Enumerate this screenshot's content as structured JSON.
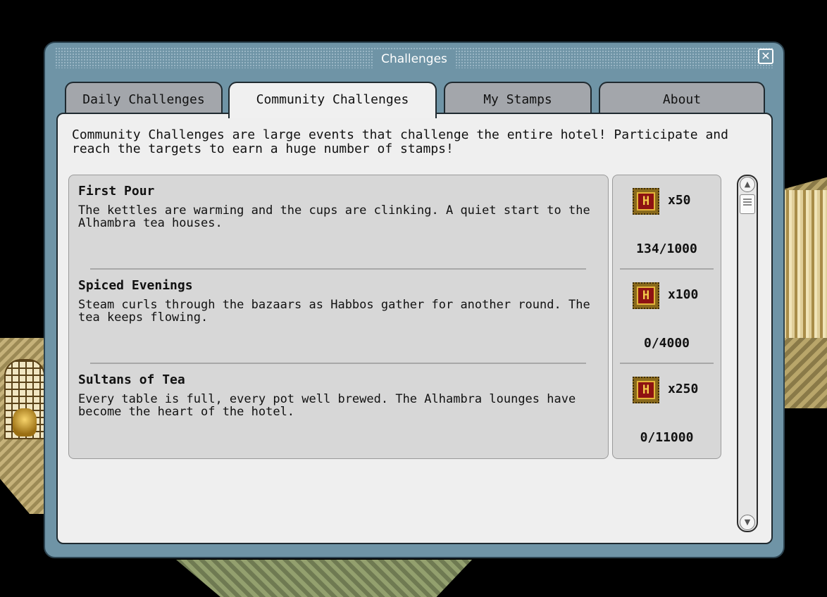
{
  "window": {
    "title": "Challenges"
  },
  "tabs": [
    {
      "label": "Daily Challenges",
      "active": false
    },
    {
      "label": "Community Challenges",
      "active": true
    },
    {
      "label": "My Stamps",
      "active": false
    },
    {
      "label": "About",
      "active": false
    }
  ],
  "intro": "Community Challenges are large events that challenge the entire hotel! Participate and reach the targets to earn a huge number of stamps!",
  "challenges": [
    {
      "title": "First Pour",
      "description": "The kettles are warming and the cups are clinking. A quiet start to the Alhambra tea houses.",
      "reward_icon_letter": "H",
      "reward": "x50",
      "progress": "134/1000"
    },
    {
      "title": "Spiced Evenings",
      "description": "Steam curls through the bazaars as Habbos gather for another round. The tea keeps flowing.",
      "reward_icon_letter": "H",
      "reward": "x100",
      "progress": "0/4000"
    },
    {
      "title": "Sultans of Tea",
      "description": "Every table is full, every pot well brewed. The Alhambra lounges have become the heart of the hotel.",
      "reward_icon_letter": "H",
      "reward": "x250",
      "progress": "0/11000"
    }
  ],
  "icons": {
    "close": "close-icon",
    "stamp": "stamp-icon",
    "scroll_up": "chevron-up-icon",
    "scroll_down": "chevron-down-icon"
  },
  "colors": {
    "window_frame": "#6f94a6",
    "panel": "#efefef",
    "list_bg": "#d7d7d7",
    "stamp_red": "#8e1212",
    "stamp_gold": "#e4b43a"
  }
}
